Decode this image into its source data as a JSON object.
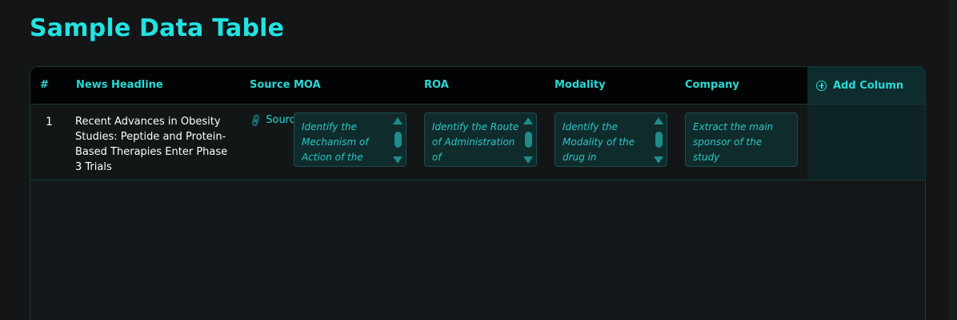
{
  "page": {
    "title": "Sample Data Table"
  },
  "table": {
    "columns": {
      "num": "#",
      "headline": "News Headline",
      "source": "Source",
      "moa": "MOA",
      "roa": "ROA",
      "modality": "Modality",
      "company": "Company",
      "add_column": "Add Column"
    },
    "rows": [
      {
        "num": "1",
        "headline": "Recent Advances in Obesity Studies: Peptide and Protein-Based Therapies Enter Phase 3 Trials",
        "source_label": "Source",
        "moa_prompt": "Identify the Mechanism of Action of the",
        "roa_prompt": "Identify the Route of Administration of",
        "modality_prompt": "Identify the Modality of the drug in",
        "company_prompt": "Extract the main sponsor of the study"
      }
    ]
  },
  "icons": {
    "add_column": "plus-circle-icon",
    "source": "link-icon"
  },
  "colors": {
    "accent": "#22e3e0",
    "background": "#131517",
    "header_bg": "#020304",
    "add_column_bg": "#0e2c2d"
  }
}
